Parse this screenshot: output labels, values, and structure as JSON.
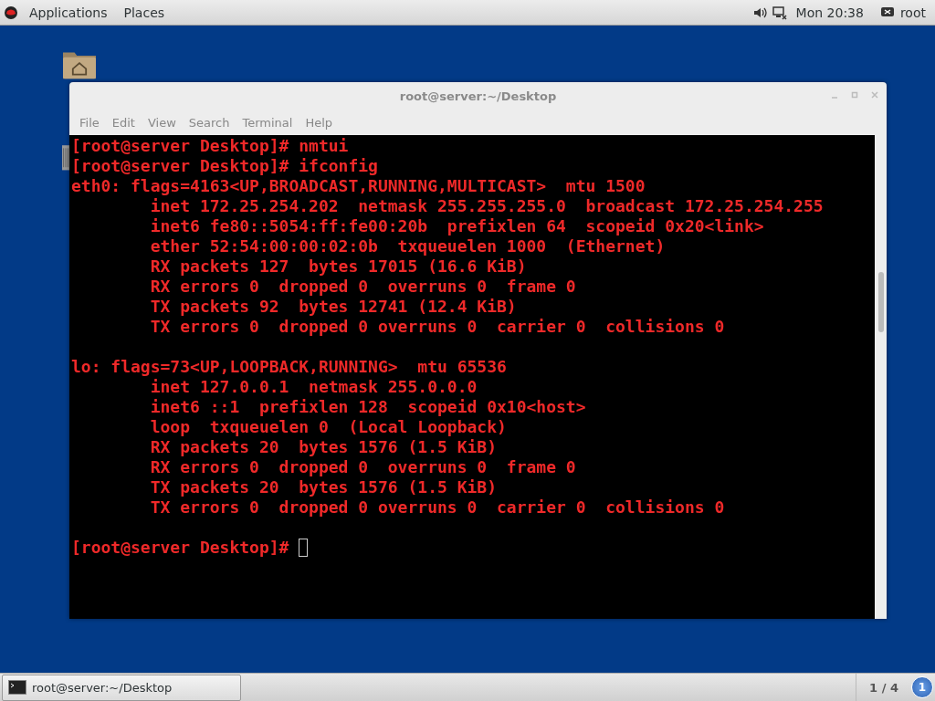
{
  "top_bar": {
    "menus": [
      "Applications",
      "Places"
    ],
    "clock": "Mon 20:38",
    "user": "root"
  },
  "window": {
    "title": "root@server:~/Desktop",
    "menu": [
      "File",
      "Edit",
      "View",
      "Search",
      "Terminal",
      "Help"
    ],
    "blocks": [
      [
        "[root@server Desktop]# nmtui",
        "[root@server Desktop]# ifconfig",
        "eth0: flags=4163<UP,BROADCAST,RUNNING,MULTICAST>  mtu 1500",
        "        inet 172.25.254.202  netmask 255.255.255.0  broadcast 172.25.254.255",
        "        inet6 fe80::5054:ff:fe00:20b  prefixlen 64  scopeid 0x20<link>",
        "        ether 52:54:00:00:02:0b  txqueuelen 1000  (Ethernet)",
        "        RX packets 127  bytes 17015 (16.6 KiB)",
        "        RX errors 0  dropped 0  overruns 0  frame 0",
        "        TX packets 92  bytes 12741 (12.4 KiB)",
        "        TX errors 0  dropped 0 overruns 0  carrier 0  collisions 0"
      ],
      [
        "lo: flags=73<UP,LOOPBACK,RUNNING>  mtu 65536",
        "        inet 127.0.0.1  netmask 255.0.0.0",
        "        inet6 ::1  prefixlen 128  scopeid 0x10<host>",
        "        loop  txqueuelen 0  (Local Loopback)",
        "        RX packets 20  bytes 1576 (1.5 KiB)",
        "        RX errors 0  dropped 0  overruns 0  frame 0",
        "        TX packets 20  bytes 1576 (1.5 KiB)",
        "        TX errors 0  dropped 0 overruns 0  carrier 0  collisions 0"
      ]
    ],
    "prompt": "[root@server Desktop]# "
  },
  "taskbar": {
    "task": "root@server:~/Desktop",
    "workspace": "1 / 4",
    "badge": "1"
  }
}
